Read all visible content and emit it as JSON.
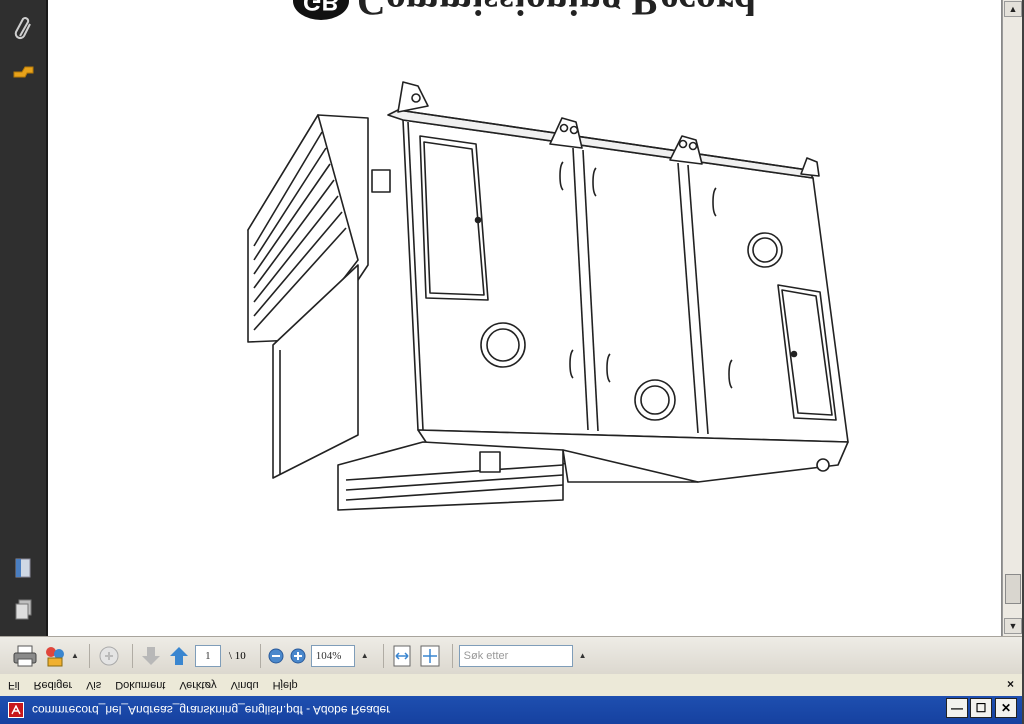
{
  "document": {
    "title_badge": "GB",
    "title_text": "Commissioning Record"
  },
  "nav_panel": {
    "items": [
      {
        "icon": "paperclip-icon"
      },
      {
        "icon": "signature-hand-icon"
      },
      {
        "icon": "pages-thumbnail-icon"
      },
      {
        "icon": "layers-icon"
      }
    ]
  },
  "toolbar": {
    "page_current": "1",
    "page_total": "\\ 10",
    "zoom_value": "104%",
    "search_placeholder": "Søk etter"
  },
  "menubar": {
    "items": [
      "Fil",
      "Rediger",
      "Vis",
      "Dokument",
      "Verktøy",
      "Vindu",
      "Hjelp"
    ],
    "close_label": "×"
  },
  "titlebar": {
    "title": "commrecord_hel_Andreas_granskning_english.pdf - Adobe Reader",
    "minimize_label": "—",
    "maximize_label": "☐",
    "close_label": "✕"
  },
  "colors": {
    "nav_background": "#2f2f2f",
    "titlebar": "#1e4fb0",
    "accent_icon": "#3a86d0"
  }
}
